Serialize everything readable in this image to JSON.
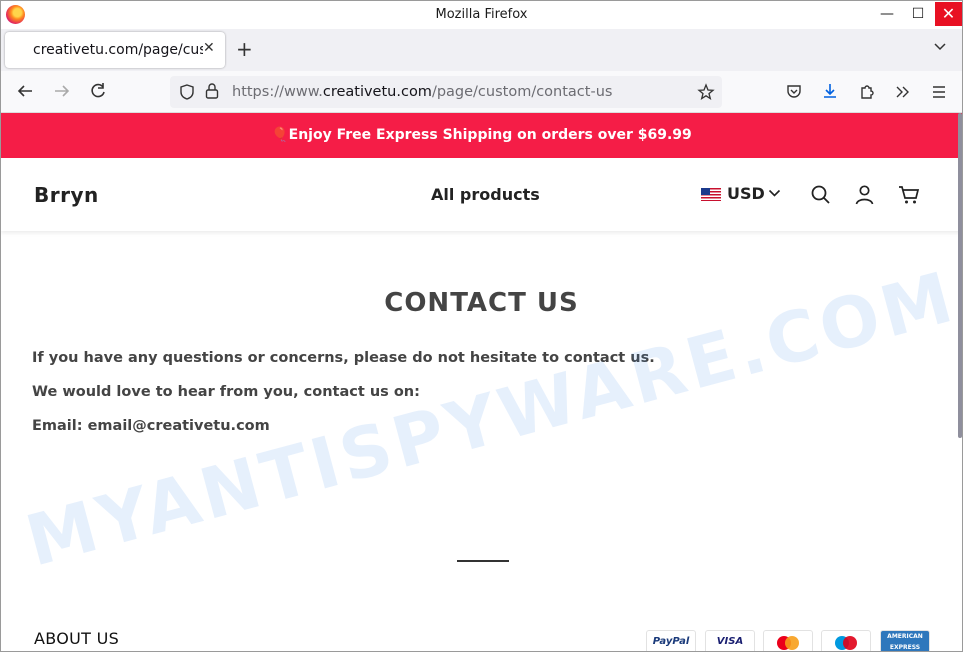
{
  "window": {
    "title": "Mozilla Firefox",
    "controls": {
      "minimize": "—",
      "maximize": "☐",
      "close": "✕"
    }
  },
  "tabs": [
    {
      "label": "creativetu.com/page/custom/contact-us",
      "active": true
    }
  ],
  "newtab_label": "+",
  "urlbar": {
    "prefix": "https://www.",
    "host": "creativetu.com",
    "path": "/page/custom/contact-us"
  },
  "promo": {
    "text": "🎈Enjoy Free Express Shipping on orders over $69.99",
    "bg": "#f51d47"
  },
  "header": {
    "brand": "Brryn",
    "nav": "All products",
    "currency": "USD"
  },
  "content": {
    "heading": "CONTACT US",
    "paragraphs": [
      "If you have any questions or concerns, please do not hesitate to contact us.",
      "We would love to hear from you, contact us on:",
      "Email: email@creativetu.com"
    ]
  },
  "footer": {
    "about_heading": "ABOUT US",
    "payments": [
      "PayPal",
      "VISA",
      "Mastercard",
      "Maestro",
      "AMERICAN EXPRESS"
    ]
  },
  "watermark": "MYANTISPYWARE.COM",
  "icons": [
    "firefox-logo",
    "back-icon",
    "forward-icon",
    "reload-icon",
    "shield-icon",
    "lock-icon",
    "star-icon",
    "pocket-icon",
    "download-icon",
    "extensions-icon",
    "overflow-icon",
    "menu-icon",
    "search-icon",
    "account-icon",
    "cart-icon"
  ]
}
